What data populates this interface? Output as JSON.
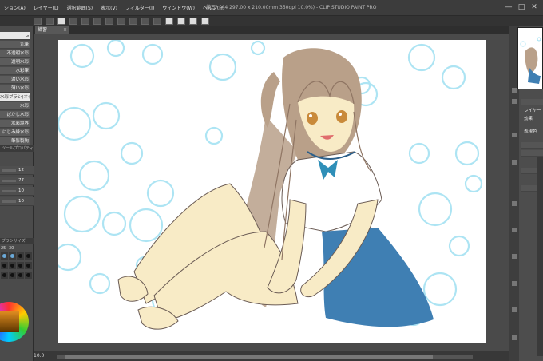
{
  "window": {
    "title": "練習* (A4 297.00 x 210.00mm 350dpi 10.0%) - CLIP STUDIO PAINT PRO",
    "minimize": "—",
    "maximize": "□",
    "close": "✕"
  },
  "menu": {
    "items": [
      "ション(A)",
      "レイヤー(L)",
      "選択範囲(S)",
      "表示(V)",
      "フィルター(I)",
      "ウィンドウ(W)",
      "ヘルプ(H)"
    ]
  },
  "document": {
    "tab_label": "練習",
    "tab_close": "×",
    "zoom": "10.0"
  },
  "sub_tools": {
    "items": [
      "G",
      "丸筆",
      "不透明水彩",
      "透明水彩",
      "水彩筆",
      "濃い水彩",
      "薄い水彩",
      "水彩ブラシ(オタ)",
      "水彩",
      "ぼかし水彩",
      "水彩境界",
      "にじみ縁水彩",
      "筆影製陶"
    ]
  },
  "tool_property": {
    "header": "ツールプロパティ",
    "rows": [
      {
        "value": "12"
      },
      {
        "value": "77"
      },
      {
        "value": "10"
      },
      {
        "value": "10"
      }
    ]
  },
  "brush_size": {
    "header": "ブラシサイズ",
    "row1": [
      "25",
      "30"
    ]
  },
  "right_panel": {
    "layer_label": "レイヤー",
    "effect_label": "効果",
    "expression_label": "表現色"
  },
  "colors": {
    "bubble": "#9fe0f2",
    "skin": "#f8ebc6",
    "hair": "#b9a089",
    "skirt": "#3f7fb3",
    "ribbon": "#2f8fb8",
    "line": "#6b5c55"
  }
}
